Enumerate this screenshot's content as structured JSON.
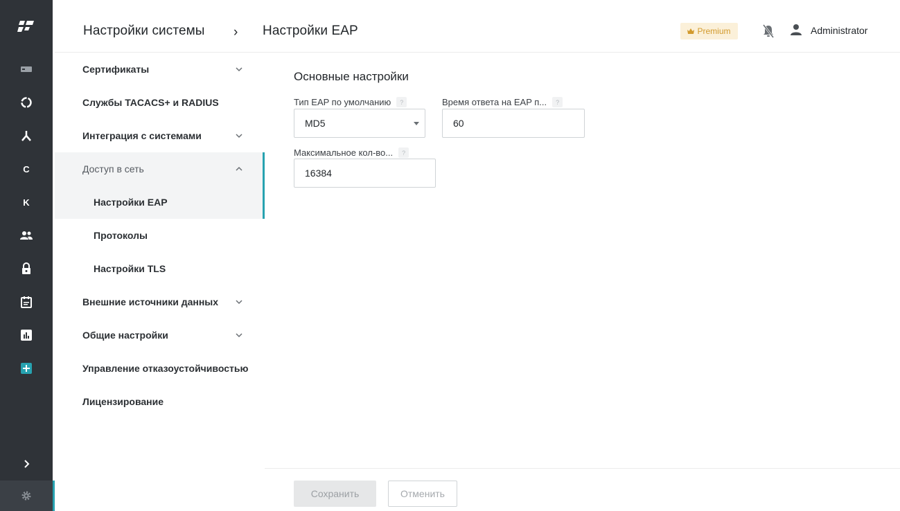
{
  "app": {
    "logo": "app-logo",
    "rail": [
      {
        "name": "server",
        "label": ""
      },
      {
        "name": "circle",
        "label": ""
      },
      {
        "name": "topology",
        "label": ""
      },
      {
        "name": "letter-c",
        "label": "C"
      },
      {
        "name": "letter-k",
        "label": "K"
      },
      {
        "name": "users",
        "label": ""
      },
      {
        "name": "lock",
        "label": ""
      },
      {
        "name": "calendar",
        "label": ""
      },
      {
        "name": "chart",
        "label": ""
      },
      {
        "name": "plus",
        "label": ""
      }
    ],
    "accent": "#27a2b0",
    "rail_bg": "#2f3338"
  },
  "header": {
    "breadcrumb_root": "Настройки системы",
    "breadcrumb_sep": "›",
    "breadcrumb_current": "Настройки EAP",
    "premium_label": "Premium",
    "user_name": "Administrator"
  },
  "nav": {
    "items": [
      {
        "label": "Сертификаты"
      },
      {
        "label": "Службы TACACS+ и RADIUS"
      },
      {
        "label": "Интеграция с системами"
      },
      {
        "label": "Доступ в сеть"
      },
      {
        "label": "Настройки EAP"
      },
      {
        "label": "Протоколы"
      },
      {
        "label": "Настройки TLS"
      },
      {
        "label": "Внешние источники данных"
      },
      {
        "label": "Общие настройки"
      },
      {
        "label": "Управление отказоустойчивостью"
      },
      {
        "label": "Лицензирование"
      }
    ]
  },
  "main": {
    "section_title": "Основные настройки",
    "fields": {
      "eap_type_label": "Тип EAP по умолчанию",
      "eap_type_value": "MD5",
      "eap_timeout_label": "Время ответа на EAP п...",
      "eap_timeout_value": "60",
      "max_count_label": "Максимальное кол-во...",
      "max_count_value": "16384",
      "help": "?"
    }
  },
  "footer": {
    "save_label": "Сохранить",
    "cancel_label": "Отменить"
  }
}
